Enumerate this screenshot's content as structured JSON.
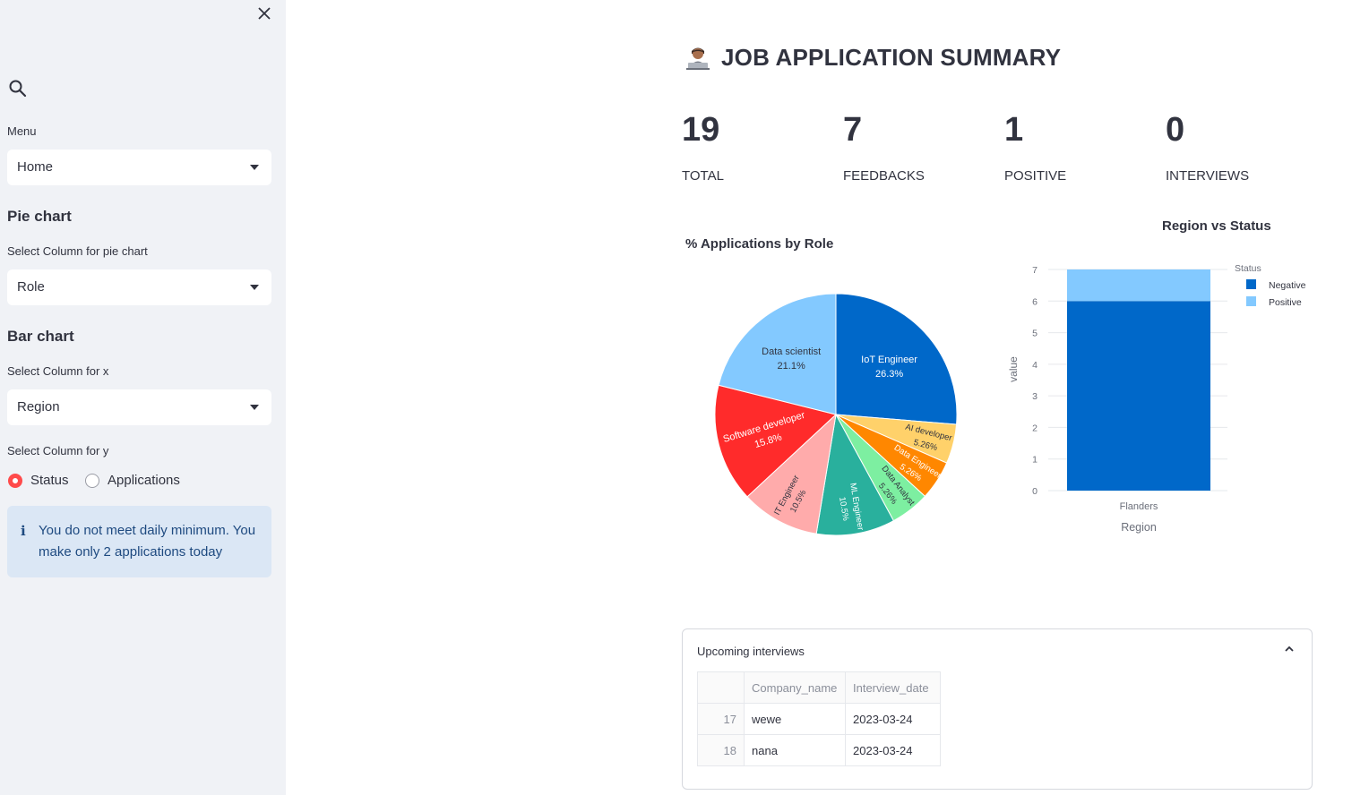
{
  "sidebar": {
    "menu_label": "Menu",
    "menu_value": "Home",
    "pie_section": "Pie chart",
    "pie_select_label": "Select Column for pie chart",
    "pie_select_value": "Role",
    "bar_section": "Bar chart",
    "x_select_label": "Select Column for x",
    "x_select_value": "Region",
    "y_select_label": "Select Column for y",
    "y_options": [
      "Status",
      "Applications"
    ],
    "y_selected": "Status",
    "info_message": "You do not meet daily minimum. You make only 2 applications today"
  },
  "header": {
    "title": "JOB APPLICATION SUMMARY"
  },
  "metrics": [
    {
      "value": "19",
      "label": "TOTAL"
    },
    {
      "value": "7",
      "label": "FEEDBACKS"
    },
    {
      "value": "1",
      "label": "POSITIVE"
    },
    {
      "value": "0",
      "label": "INTERVIEWS"
    }
  ],
  "colors": {
    "accent": "#ff4b4b",
    "info_bg": "#dbe7f5",
    "sidebar_bg": "#f0f2f6"
  },
  "chart_data": [
    {
      "type": "pie",
      "title": "% Applications by Role",
      "slices": [
        {
          "label": "IoT Engineer",
          "pct_label": "26.3%",
          "value": 26.3,
          "color": "#0068c9"
        },
        {
          "label": "AI developer",
          "pct_label": "5.26%",
          "value": 5.26,
          "color": "#ffd16a"
        },
        {
          "label": "Data Engineer",
          "pct_label": "5.26%",
          "value": 5.26,
          "color": "#ff8700"
        },
        {
          "label": "Data Analyst",
          "pct_label": "5.26%",
          "value": 5.26,
          "color": "#7defa1"
        },
        {
          "label": "ML Engineer",
          "pct_label": "10.5%",
          "value": 10.5,
          "color": "#29b09d"
        },
        {
          "label": "IT Engineer",
          "pct_label": "10.5%",
          "value": 10.5,
          "color": "#ffabab"
        },
        {
          "label": "Software developer",
          "pct_label": "15.8%",
          "value": 15.8,
          "color": "#ff2b2b"
        },
        {
          "label": "Data scientist",
          "pct_label": "21.1%",
          "value": 21.1,
          "color": "#83c9ff"
        }
      ]
    },
    {
      "type": "bar",
      "title": "Region vs Status",
      "xlabel": "Region",
      "ylabel": "value",
      "categories": [
        "Flanders"
      ],
      "stacked": true,
      "legend_title": "Status",
      "legend_position": "top-right",
      "ylim": [
        0,
        7
      ],
      "yticks": [
        "0",
        "1",
        "2",
        "3",
        "4",
        "5",
        "6",
        "7"
      ],
      "series": [
        {
          "name": "Negative",
          "values": [
            6
          ],
          "color": "#0068c9"
        },
        {
          "name": "Positive",
          "values": [
            1
          ],
          "color": "#83c9ff"
        }
      ]
    }
  ],
  "interviews": {
    "header": "Upcoming interviews",
    "columns": [
      "Company_name",
      "Interview_date"
    ],
    "rows": [
      {
        "index": "17",
        "company": "wewe",
        "date": "2023-03-24"
      },
      {
        "index": "18",
        "company": "nana",
        "date": "2023-03-24"
      }
    ]
  }
}
